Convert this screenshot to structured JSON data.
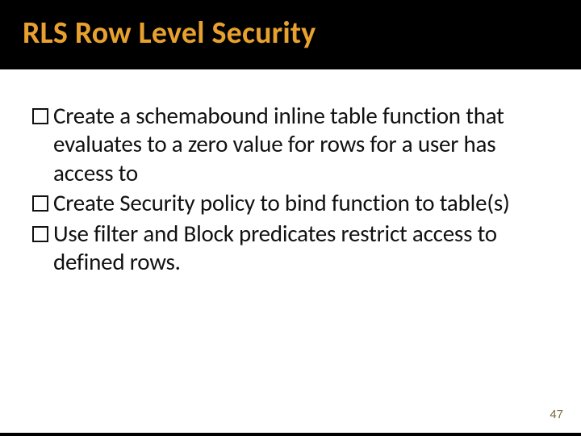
{
  "slide": {
    "title": "RLS Row Level Security",
    "bullets": [
      {
        "text": "Create a schemabound inline table function that evaluates to a zero value for rows for a user has access to"
      },
      {
        "text": "Create Security policy to bind function to table(s)"
      },
      {
        "text": "Use  filter and Block predicates restrict access to defined rows."
      }
    ],
    "page_number": "47"
  }
}
